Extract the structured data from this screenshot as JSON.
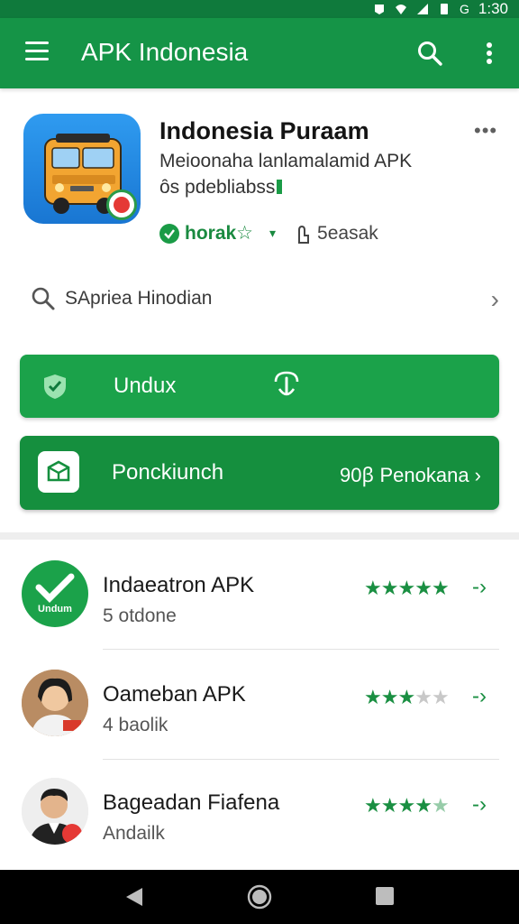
{
  "status_bar": {
    "network": "G",
    "time": "1:30"
  },
  "app_bar": {
    "title": "APK Indonesia"
  },
  "app": {
    "title": "Indonesia Puraam",
    "subtitle1": "Meioonaha lanlamalamid APK",
    "subtitle2": "ȏs pdebliabss",
    "rating_text": "horak☆",
    "downloads": "5easak"
  },
  "search": {
    "text": "SApriea Hinodian"
  },
  "install_button": {
    "label": "Undux"
  },
  "promo_button": {
    "label": "Ponckiunch",
    "right_text": "90ꞵ Penokana ›"
  },
  "list": [
    {
      "name": "Indaeatron APK",
      "sub": "5 otdone",
      "stars": 5,
      "avatar_label": "Undum"
    },
    {
      "name": "Oameban APK",
      "sub": "4 baolik",
      "stars": 3
    },
    {
      "name": "Bageadan Fiafena",
      "sub": "Andailk",
      "stars": 4.5
    }
  ],
  "colors": {
    "appbar": "#159447",
    "status": "#0f7a3c",
    "accent": "#1ba24a",
    "star": "#1a8f42"
  }
}
